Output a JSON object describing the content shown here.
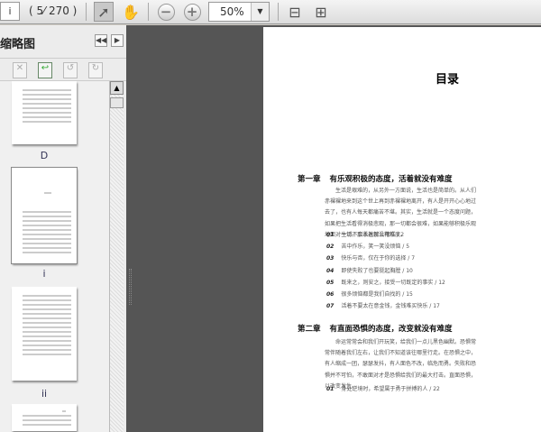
{
  "toolbar": {
    "page_input": "i",
    "page_count": "( 5⁄ 270 )",
    "zoom": "50%"
  },
  "sidebar": {
    "title": "缩略图",
    "thumb_labels": [
      "D",
      "i",
      "ii"
    ]
  },
  "document": {
    "title": "目录",
    "chapters": [
      {
        "number": "第一章",
        "heading": "有乐观积极的态度，活着就没有难度",
        "intro": "生活是艰难的，从另外一方面说，生活也是简单的。从人们赤裸裸地来到这个世上再到赤裸裸地离开，有人是开开心心地过去了，也有人每天都痛苦不堪。其实，生活就是一个态度问题，如果把生活看得消极悲观，那一切都会很难，如果能够积极乐观地面对一切，那活着就没有难度。",
        "items": [
          {
            "num": "01",
            "text": "生活不会永远那么糟糕 / 2"
          },
          {
            "num": "02",
            "text": "苦中作乐，笑一笑没烦恼 / 5"
          },
          {
            "num": "03",
            "text": "快乐与否，仅在于你的选择 / 7"
          },
          {
            "num": "04",
            "text": "即使失败了也要挺起胸膛 / 10"
          },
          {
            "num": "05",
            "text": "既来之，则安之，接受一切既定的事实 / 12"
          },
          {
            "num": "06",
            "text": "很多烦恼都是我们自找的 / 15"
          },
          {
            "num": "07",
            "text": "活着不要太在意金钱，金钱难买快乐 / 17"
          }
        ]
      },
      {
        "number": "第二章",
        "heading": "有直面恐惧的态度，改变就没有难度",
        "intro": "命运常常会和我们开玩笑，给我们一点儿黑色幽默。恐惧常常伴随着我们左右，让我们不知道该往哪里行走。在恐惧之中，有人缩成一团，瑟瑟发抖，有人面色不改，临危而勇。失败和恐惧并不可怕，不敢面对才是恐惧给我们的最大打击。直面恐惧，以改变发生。",
        "items": [
          {
            "num": "01",
            "text": "身处逆境时，希望属于勇于拼搏的人 / 22"
          }
        ]
      }
    ]
  }
}
